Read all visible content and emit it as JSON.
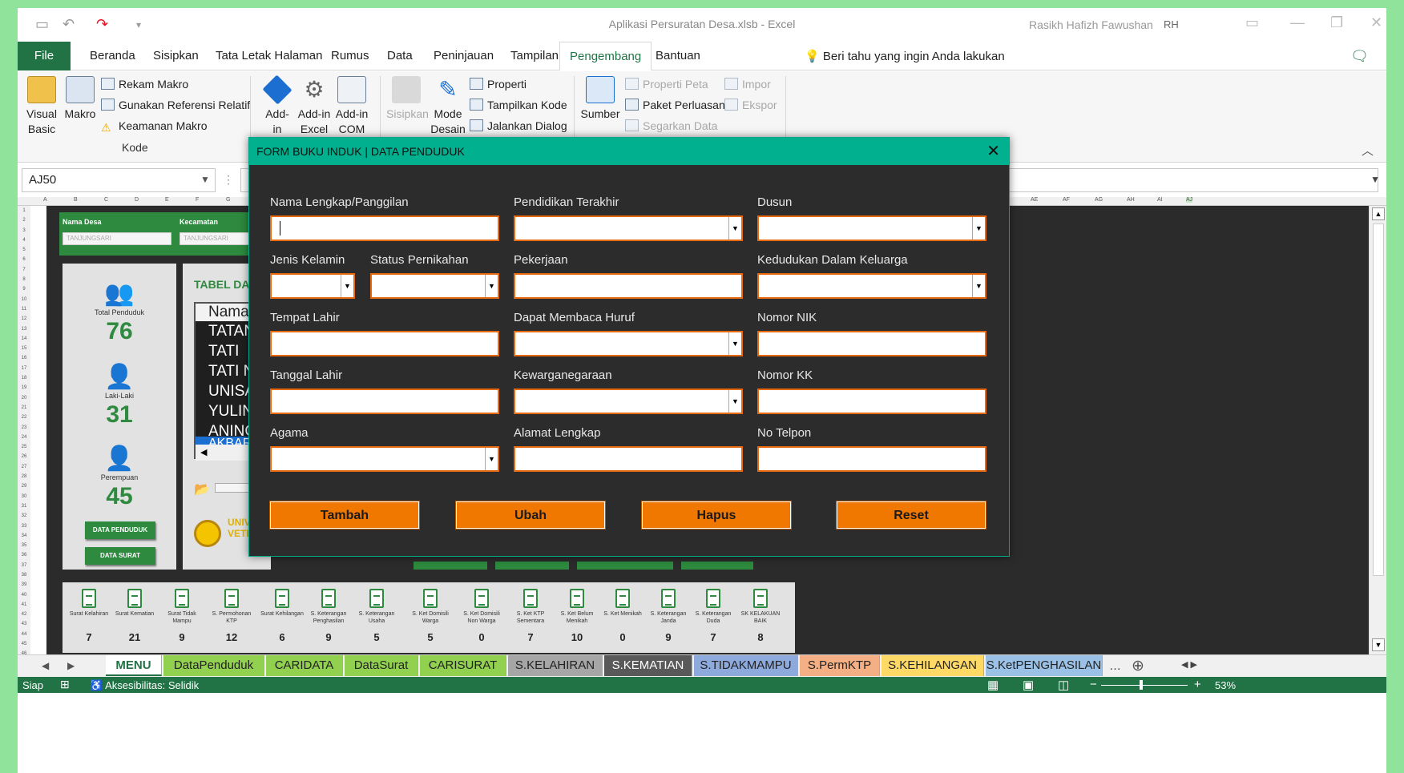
{
  "window": {
    "title": "Aplikasi Persuratan Desa.xlsb - Excel",
    "user_name": "Rasikh Hafizh Fawushan",
    "user_initials": "RH"
  },
  "menu": {
    "tabs": [
      "File",
      "Beranda",
      "Sisipkan",
      "Tata Letak Halaman",
      "Rumus",
      "Data",
      "Peninjauan",
      "Tampilan",
      "Pengembang",
      "Bantuan"
    ],
    "active": "Pengembang",
    "tell_me": "Beri tahu yang ingin Anda lakukan"
  },
  "ribbon": {
    "visual_basic": [
      "Visual",
      "Basic"
    ],
    "makro": "Makro",
    "rekam_makro": "Rekam Makro",
    "referensi_relatif": "Gunakan Referensi Relatif",
    "keamanan_makro": "Keamanan Makro",
    "kode_group": "Kode",
    "addin": [
      "Add-",
      "in"
    ],
    "addin_excel": [
      "Add-in",
      "Excel"
    ],
    "addin_com": [
      "Add-in",
      "COM"
    ],
    "sisipkan": "Sisipkan",
    "mode_desain": [
      "Mode",
      "Desain"
    ],
    "properti": "Properti",
    "tampilkan_kode": "Tampilkan Kode",
    "jalankan_dialog": "Jalankan Dialog",
    "sumber": "Sumber",
    "properti_peta": "Properti Peta",
    "paket_perluasan": "Paket Perluasan",
    "segarkan_data": "Segarkan Data",
    "impor": "Impor",
    "ekspor": "Ekspor"
  },
  "formula_bar": {
    "name_box": "AJ50"
  },
  "columns": [
    "A",
    "B",
    "C",
    "D",
    "E",
    "F",
    "G",
    "AE",
    "AF",
    "AG",
    "AH",
    "AI",
    "AJ"
  ],
  "dashboard": {
    "nama_desa_label": "Nama Desa",
    "nama_desa_value": "TANJUNGSARI",
    "kecamatan_label": "Kecamatan",
    "kecamatan_value": "TANJUNGSARI",
    "total_label": "Total Penduduk",
    "total_value": "76",
    "laki_label": "Laki-Laki",
    "laki_value": "31",
    "perempuan_label": "Perempuan",
    "perempuan_value": "45",
    "btn_data_penduduk": "DATA PENDUDUK",
    "btn_data_surat": "DATA SURAT",
    "table_title": "TABEL DATA",
    "list_header": "Nama P",
    "list_items": [
      "TATANG",
      "TATI",
      "TATI NU",
      "UNISAH",
      "YULINDA",
      "ANING",
      "AKBAR"
    ],
    "logo_text": [
      "UNIVERS",
      "VETERAN"
    ],
    "docs": [
      {
        "label": "Surat Kelahiran",
        "value": "7"
      },
      {
        "label": "Surat Kematian",
        "value": "21"
      },
      {
        "label": "Surat Tidak Mampu",
        "value": "9"
      },
      {
        "label": "S. Permohonan KTP",
        "value": "12"
      },
      {
        "label": "Surat Kehilangan",
        "value": "6"
      },
      {
        "label": "S. Keterangan Penghasilan",
        "value": "9"
      },
      {
        "label": "S. Keterangan Usaha",
        "value": "5"
      },
      {
        "label": "S. Ket Domisili Warga",
        "value": "5"
      },
      {
        "label": "S. Ket Domisili Non Warga",
        "value": "0"
      },
      {
        "label": "S. Ket KTP Sementara",
        "value": "7"
      },
      {
        "label": "S. Ket Belum Menikah",
        "value": "10"
      },
      {
        "label": "S. Ket Menikah",
        "value": "0"
      },
      {
        "label": "S. Keterangan Janda",
        "value": "9"
      },
      {
        "label": "S. Keterangan Duda",
        "value": "7"
      },
      {
        "label": "SK KELAKUAN BAIK",
        "value": "8"
      }
    ]
  },
  "form": {
    "title": "FORM BUKU INDUK | DATA PENDUDUK",
    "labels": {
      "nama": "Nama Lengkap/Panggilan",
      "pendidikan": "Pendidikan Terakhir",
      "dusun": "Dusun",
      "jenis_kelamin": "Jenis Kelamin",
      "status_pernikahan": "Status Pernikahan",
      "pekerjaan": "Pekerjaan",
      "kedudukan": "Kedudukan Dalam Keluarga",
      "tempat_lahir": "Tempat Lahir",
      "membaca": "Dapat Membaca Huruf",
      "nik": "Nomor NIK",
      "tanggal_lahir": "Tanggal Lahir",
      "kewarganegaraan": "Kewarganegaraan",
      "kk": "Nomor KK",
      "agama": "Agama",
      "alamat": "Alamat Lengkap",
      "telpon": "No Telpon"
    },
    "buttons": {
      "tambah": "Tambah",
      "ubah": "Ubah",
      "hapus": "Hapus",
      "reset": "Reset"
    }
  },
  "sheet_tabs": [
    {
      "name": "MENU",
      "color": "#ffffff"
    },
    {
      "name": "DataPenduduk",
      "color": "#92d050"
    },
    {
      "name": "CARIDATA",
      "color": "#92d050"
    },
    {
      "name": "DataSurat",
      "color": "#92d050"
    },
    {
      "name": "CARISURAT",
      "color": "#92d050"
    },
    {
      "name": "S.KELAHIRAN",
      "color": "#a6a6a6"
    },
    {
      "name": "S.KEMATIAN",
      "color": "#595959"
    },
    {
      "name": "S.TIDAKMAMPU",
      "color": "#8ea9db"
    },
    {
      "name": "S.PermKTP",
      "color": "#f4b084"
    },
    {
      "name": "S.KEHILANGAN",
      "color": "#ffd966"
    },
    {
      "name": "S.KetPENGHASILAN",
      "color": "#9bc2e6"
    }
  ],
  "status": {
    "ready": "Siap",
    "accessibility": "Aksesibilitas: Selidik",
    "zoom": "53%"
  },
  "colors": {
    "excel_green": "#217346",
    "form_accent": "#00b08e",
    "button_orange": "#f07800",
    "input_border": "#e86a10"
  }
}
